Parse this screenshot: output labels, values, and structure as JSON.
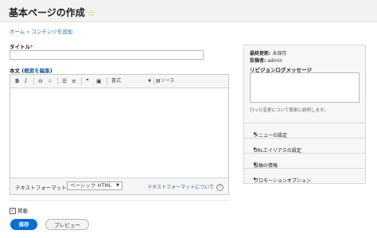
{
  "page": {
    "title": "基本ページの作成",
    "star_glyph": "☆"
  },
  "breadcrumb": {
    "items": [
      "ホーム",
      "コンテンツを追加"
    ],
    "separator": "»"
  },
  "form": {
    "title_label": "タイトル",
    "required_mark": "*",
    "body_label": "本文",
    "body_summary_open": "(",
    "body_summary_link": "概要を編集",
    "body_summary_close": ")",
    "toolbar": {
      "bold": "B",
      "italic": "I",
      "link_glyph": "⊖",
      "unlink_glyph": "⊘",
      "bullet_list_glyph": "☰",
      "numbered_list_glyph": "≡",
      "blockquote_glyph": "❞",
      "image_glyph": "▣",
      "style_select": "書式",
      "source_label": "ソース",
      "source_glyph": "▤"
    },
    "text_format": {
      "label": "テキストフォーマット",
      "selected": "ベーシック HTML",
      "help_link": "テキストフォーマットについて",
      "help_glyph": "?"
    },
    "publish_label": "掲載",
    "publish_checked": true,
    "save_button": "保存",
    "preview_button": "プレビュー"
  },
  "sidebar": {
    "last_saved_label": "最終更新:",
    "last_saved_value": "未保存",
    "author_label": "投稿者:",
    "author_value": "admin",
    "revision_log_label": "リビジョンログメッセージ",
    "revision_log_help": "行った変更について簡単に説明します。",
    "sections": [
      {
        "label": "メニューの設定"
      },
      {
        "label": "URLエイリアスの設定"
      },
      {
        "label": "投稿の情報"
      },
      {
        "label": "プロモーションオプション"
      }
    ],
    "section_glyph": "▶"
  },
  "colors": {
    "link": "#2766aa",
    "primary_button": "#0b6ed1",
    "star": "#d7b21a",
    "required": "#c0392b",
    "header_bg": "#f2f2f0",
    "sidebar_bg": "#f7f7f7"
  }
}
